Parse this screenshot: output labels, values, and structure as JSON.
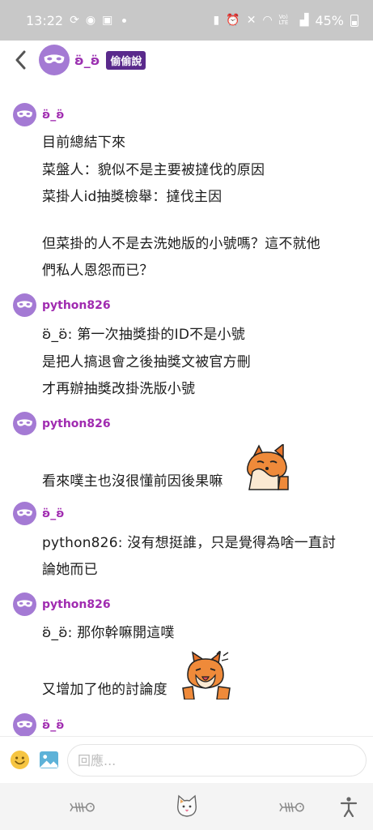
{
  "status_bar": {
    "time": "13:22",
    "battery": "45%",
    "signal_label": "Vo) LTE"
  },
  "header": {
    "name": "ʚ̈_ʚ̈",
    "badge": "偷偷說"
  },
  "messages": [
    {
      "author": "ʚ̈_ʚ̈",
      "lines": [
        "目前總結下來",
        "菜盤人：貌似不是主要被撻伐的原因",
        "菜掛人id抽獎檢舉：撻伐主因",
        "但菜掛的人不是去洗她版的小號嗎？這不就他",
        "們私人恩怨而已？"
      ]
    },
    {
      "author": "python826",
      "lines": [
        "ʚ̈_ʚ̈: 第一次抽獎掛的ID不是小號",
        "是把人搞退會之後抽獎文被官方刪",
        "才再辦抽獎改掛洗版小號"
      ]
    },
    {
      "author": "python826",
      "lines": [
        "看來噗主也沒很懂前因後果嘛"
      ]
    },
    {
      "author": "ʚ̈_ʚ̈",
      "lines": [
        "python826: 沒有想挺誰，只是覺得為啥一直討",
        "論她而已"
      ]
    },
    {
      "author": "python826",
      "lines": [
        "ʚ̈_ʚ̈: 那你幹嘛開這噗",
        "又增加了他的討論度"
      ]
    },
    {
      "author": "ʚ̈_ʚ̈",
      "lines": []
    }
  ],
  "reply": {
    "placeholder": "回應..."
  },
  "icons": {
    "back": "chevron-left-icon",
    "avatar": "purple-mask-avatar",
    "emoji": "smiley-icon",
    "image": "image-icon",
    "nav": [
      "fishbone-icon",
      "cat-face-icon",
      "fishbone-icon",
      "accessibility-icon"
    ]
  },
  "colors": {
    "status_bar": "#c8c8c8",
    "author_name": "#a02bb0",
    "badge_bg": "#5a2a8c",
    "avatar": "#9b6fcf"
  }
}
